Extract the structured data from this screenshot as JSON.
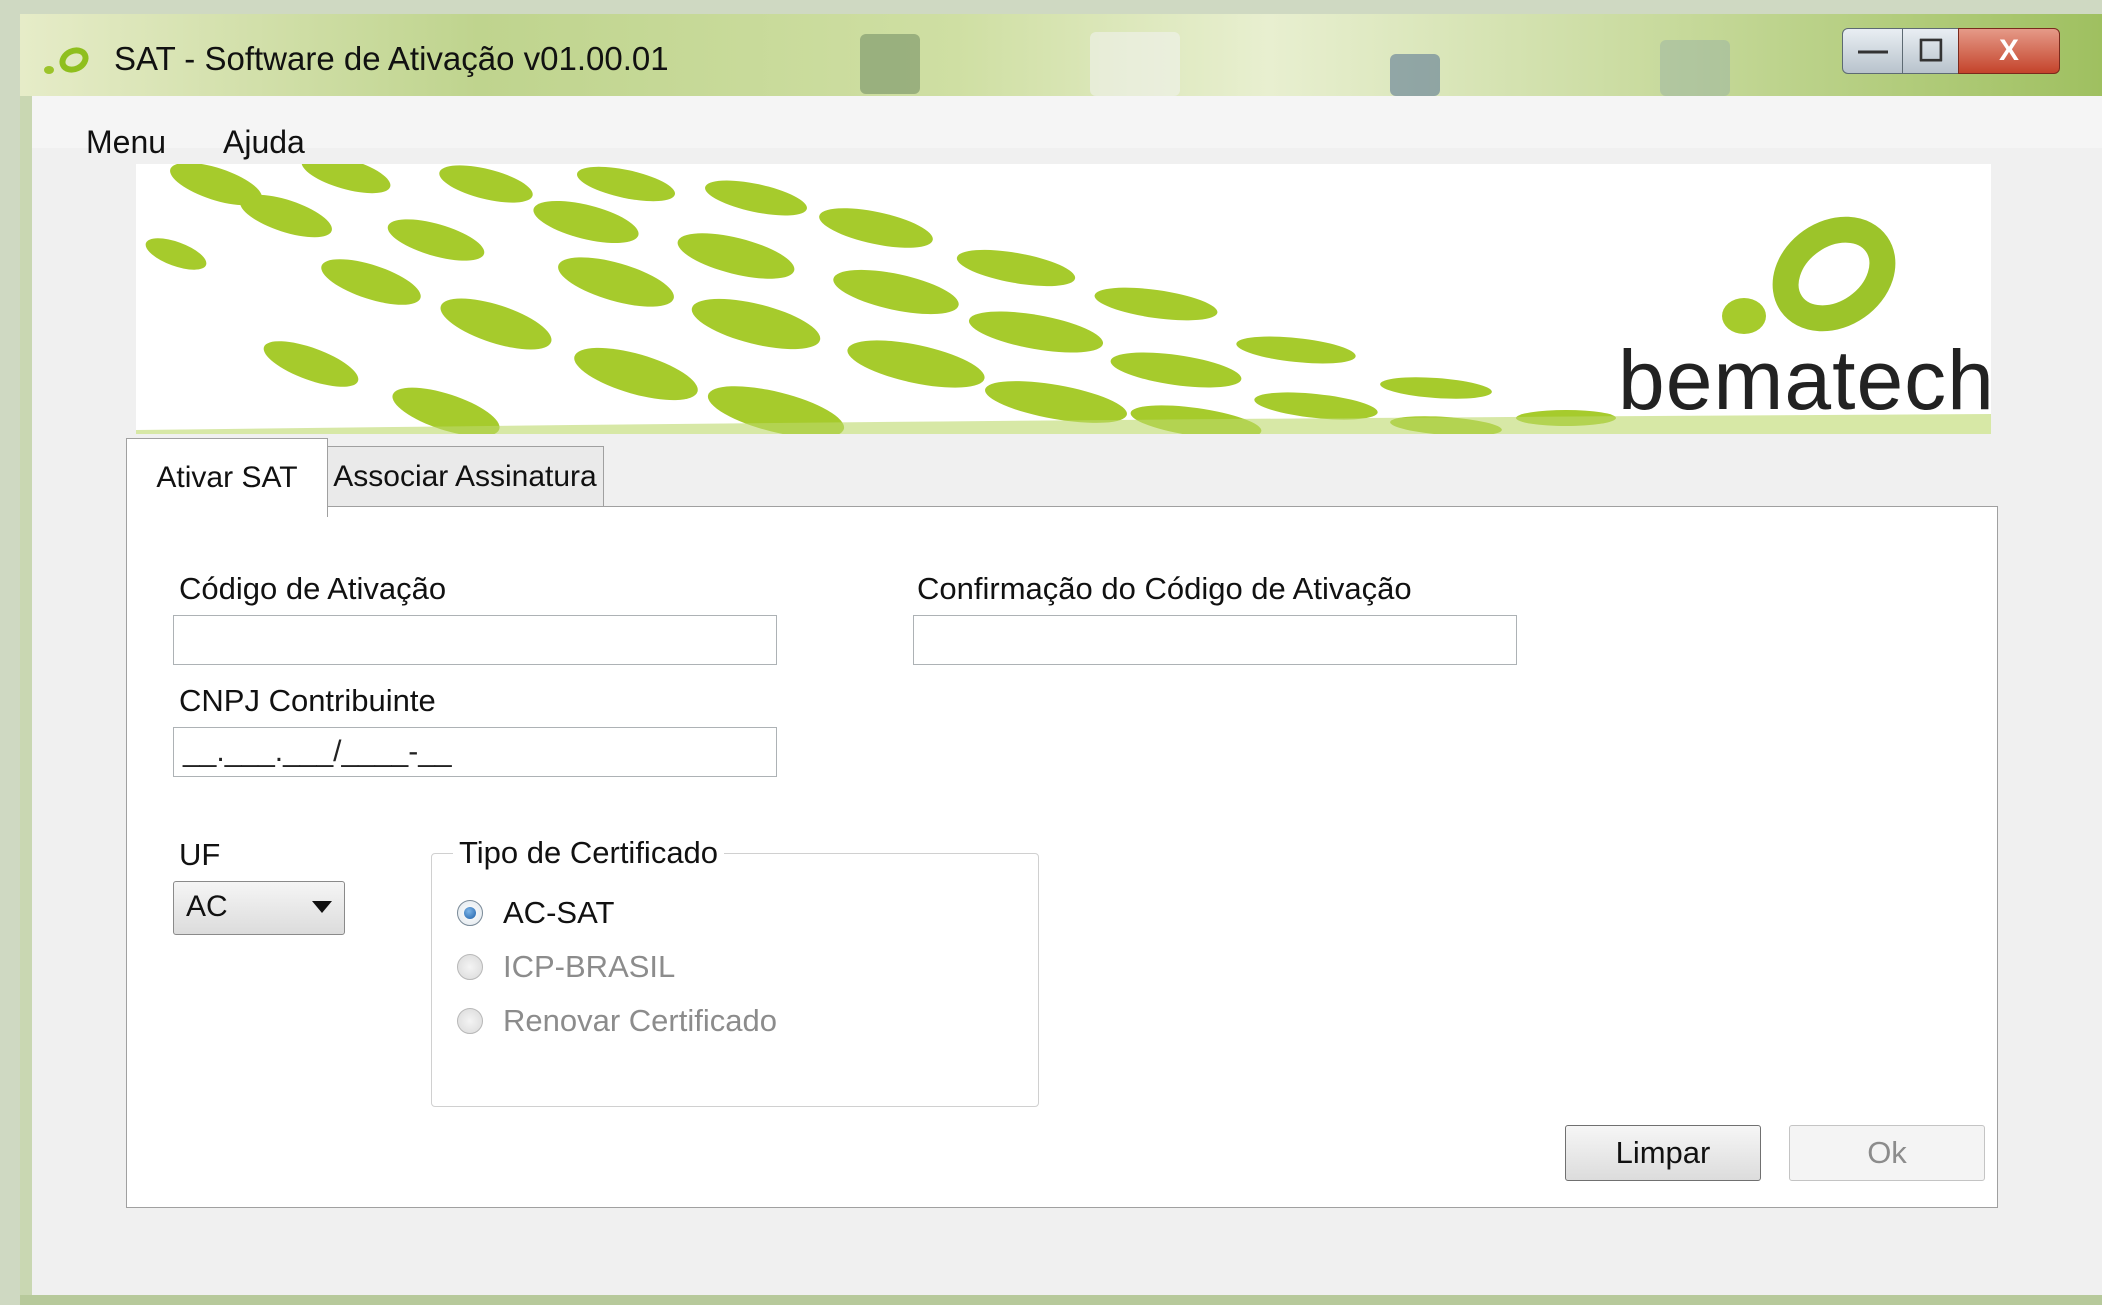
{
  "window": {
    "title": "SAT - Software de Ativação v01.00.01",
    "controls": {
      "minimize": "—",
      "maximize": "☐",
      "close": "X"
    }
  },
  "menubar": {
    "items": [
      "Menu",
      "Ajuda"
    ]
  },
  "banner": {
    "brand": "bematech"
  },
  "tabs": [
    {
      "label": "Ativar SAT",
      "selected": true
    },
    {
      "label": "Associar Assinatura",
      "selected": false
    }
  ],
  "form": {
    "codigo_label": "Código de Ativação",
    "codigo_value": "",
    "confirmacao_label": "Confirmação do Código de Ativação",
    "confirmacao_value": "",
    "cnpj_label": "CNPJ Contribuinte",
    "cnpj_mask": "__.___.___/____-__",
    "uf_label": "UF",
    "uf_value": "AC",
    "tipo_certificado": {
      "legend": "Tipo de Certificado",
      "options": [
        {
          "label": "AC-SAT",
          "checked": true,
          "enabled": true
        },
        {
          "label": "ICP-BRASIL",
          "checked": false,
          "enabled": false
        },
        {
          "label": "Renovar Certificado",
          "checked": false,
          "enabled": false
        }
      ]
    }
  },
  "buttons": {
    "limpar": "Limpar",
    "ok": "Ok"
  },
  "colors": {
    "accent_green": "#9cc42a",
    "selected_radio": "#1d5fa8"
  },
  "icons": {
    "app": "bematech-logo-icon",
    "uf_dropdown": "chevron-down-icon"
  }
}
